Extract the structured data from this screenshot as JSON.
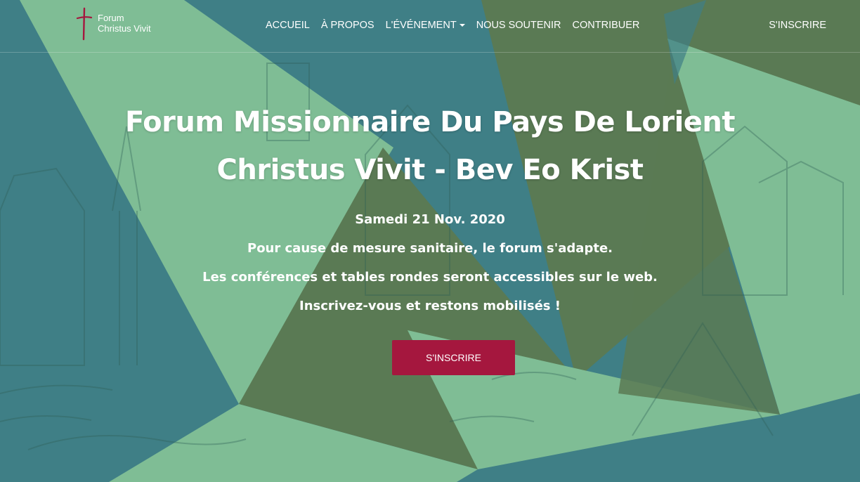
{
  "brand": {
    "line1": "Forum",
    "line2": "Christus Vivit"
  },
  "nav": {
    "items": [
      {
        "label": "ACCUEIL"
      },
      {
        "label": "À PROPOS"
      },
      {
        "label": "L'ÉVÉNEMENT"
      },
      {
        "label": "NOUS SOUTENIR"
      },
      {
        "label": "CONTRIBUER"
      }
    ],
    "register": "S'INSCRIRE"
  },
  "hero": {
    "title_line1": "Forum Missionnaire Du Pays De Lorient",
    "title_line2": "Christus Vivit - Bev Eo Krist",
    "date": "Samedi 21 Nov. 2020",
    "line1": "Pour cause de mesure sanitaire, le forum s'adapte.",
    "line2": "Les conférences et tables rondes seront accessibles sur le web.",
    "line3": "Inscrivez-vous et restons mobilisés !",
    "cta": "S'INSCRIRE"
  },
  "colors": {
    "teal": "#3f7f86",
    "light_green": "#7fbd95",
    "olive_green": "#5a7a54",
    "cta": "#a5173e",
    "cross": "#a5173e"
  }
}
